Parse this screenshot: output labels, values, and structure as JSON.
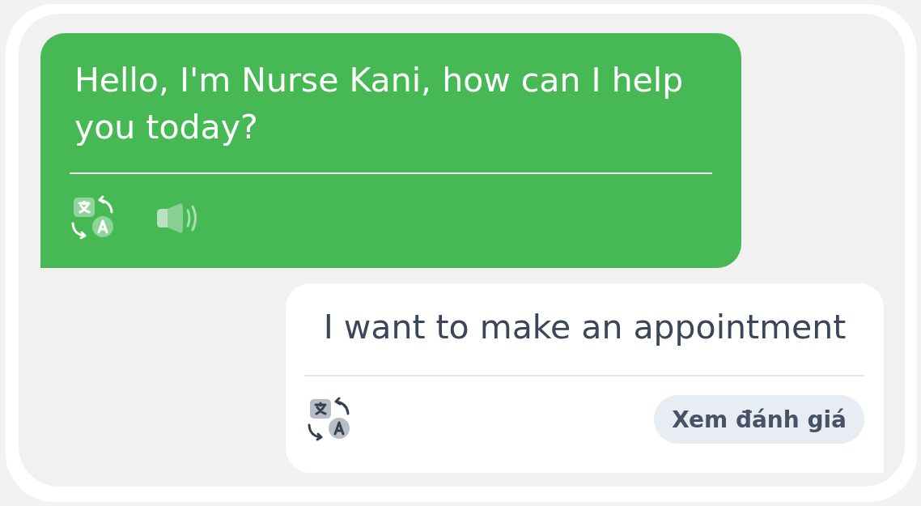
{
  "chat": {
    "messages": [
      {
        "kind": "bot",
        "text": "Hello, I'm Nurse Kani, how can I help you today?"
      },
      {
        "kind": "user",
        "text": "I want to make an appointment",
        "review_button": "Xem đánh giá"
      }
    ]
  }
}
